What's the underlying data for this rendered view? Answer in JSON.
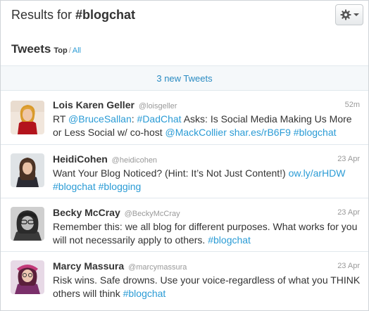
{
  "header": {
    "title_prefix": "Results for ",
    "title_hashtag": "#blogchat",
    "gear_icon": "gear-icon",
    "dropdown_icon": "caret-down-icon"
  },
  "tabs": {
    "title": "Tweets",
    "top": "Top",
    "separator": "/",
    "all": "All"
  },
  "new_tweets": "3 new Tweets",
  "colors": {
    "link": "#2a9bd5",
    "new_tweets_text": "#2a8bc2",
    "bar_background": "#f5f8fa",
    "muted_text": "#999999"
  },
  "tweets": [
    {
      "fullname": "Lois Karen Geller",
      "username": "@loisgeller",
      "time": "52m",
      "segments": [
        {
          "t": "RT ",
          "link": false
        },
        {
          "t": "@BruceSallan",
          "link": true
        },
        {
          "t": ": ",
          "link": false
        },
        {
          "t": "#DadChat",
          "link": true
        },
        {
          "t": " Asks: Is Social Media Making Us More or Less Social w/ co-host ",
          "link": false
        },
        {
          "t": "@MackCollier",
          "link": true
        },
        {
          "t": " ",
          "link": false
        },
        {
          "t": "shar.es/rB6F9",
          "link": true
        },
        {
          "t": " ",
          "link": false
        },
        {
          "t": "#blogchat",
          "link": true
        }
      ]
    },
    {
      "fullname": "HeidiCohen",
      "username": "@heidicohen",
      "time": "23 Apr",
      "segments": [
        {
          "t": "Want Your Blog Noticed? (Hint: It’s Not Just Content!) ",
          "link": false
        },
        {
          "t": "ow.ly/arHDW",
          "link": true
        },
        {
          "t": " ",
          "link": false
        },
        {
          "t": "#blogchat",
          "link": true
        },
        {
          "t": " ",
          "link": false
        },
        {
          "t": "#blogging",
          "link": true
        }
      ]
    },
    {
      "fullname": "Becky McCray",
      "username": "@BeckyMcCray",
      "time": "23 Apr",
      "segments": [
        {
          "t": "Remember this: we all blog for different purposes. What works for you will not necessarily apply to others. ",
          "link": false
        },
        {
          "t": "#blogchat",
          "link": true
        }
      ]
    },
    {
      "fullname": "Marcy Massura",
      "username": "@marcymassura",
      "time": "23 Apr",
      "segments": [
        {
          "t": "Risk wins. Safe drowns. Use your voice-regardless of what you THINK others will think ",
          "link": false
        },
        {
          "t": "#blogchat",
          "link": true
        }
      ]
    }
  ]
}
